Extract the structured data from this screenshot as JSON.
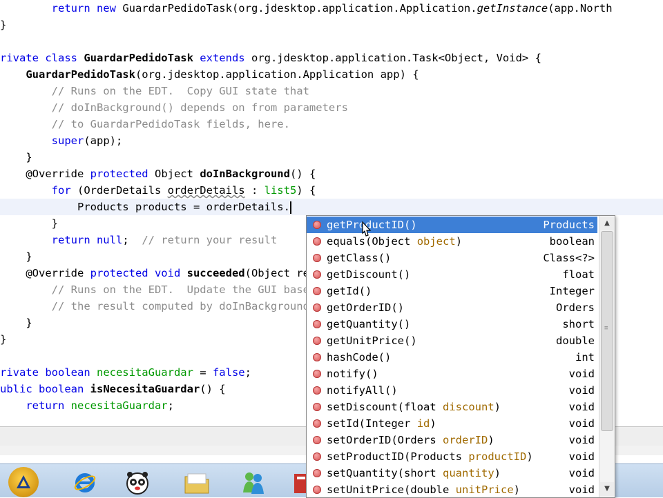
{
  "editor": {
    "lines": [
      {
        "segs": [
          {
            "t": "        return new ",
            "c": "kw"
          },
          {
            "t": "GuardarPedidoTask(org.jdesktop.application.Application.",
            "c": "typ"
          },
          {
            "t": "getInstance",
            "c": "it"
          },
          {
            "t": "(app.North",
            "c": "typ"
          }
        ]
      },
      {
        "segs": [
          {
            "t": "}",
            "c": "typ"
          }
        ]
      },
      {
        "segs": [
          {
            "t": "",
            "c": "typ"
          }
        ]
      },
      {
        "segs": [
          {
            "t": "rivate class ",
            "c": "kw"
          },
          {
            "t": "GuardarPedidoTask",
            "c": "bold"
          },
          {
            "t": " extends ",
            "c": "kw"
          },
          {
            "t": "org.jdesktop.application.Task<Object, Void> {",
            "c": "typ"
          }
        ]
      },
      {
        "segs": [
          {
            "t": "    GuardarPedidoTask",
            "c": "bold"
          },
          {
            "t": "(org.jdesktop.application.Application app) {",
            "c": "typ"
          }
        ]
      },
      {
        "segs": [
          {
            "t": "        // Runs on the EDT.  Copy GUI state that",
            "c": "cm"
          }
        ]
      },
      {
        "segs": [
          {
            "t": "        // doInBackground() depends on from parameters",
            "c": "cm"
          }
        ]
      },
      {
        "segs": [
          {
            "t": "        // to GuardarPedidoTask fields, here.",
            "c": "cm"
          }
        ]
      },
      {
        "segs": [
          {
            "t": "        super",
            "c": "kw"
          },
          {
            "t": "(app);",
            "c": "typ"
          }
        ]
      },
      {
        "segs": [
          {
            "t": "    }",
            "c": "typ"
          }
        ]
      },
      {
        "segs": [
          {
            "t": "    @Override ",
            "c": "typ"
          },
          {
            "t": "protected ",
            "c": "kw"
          },
          {
            "t": "Object ",
            "c": "typ"
          },
          {
            "t": "doInBackground",
            "c": "bold"
          },
          {
            "t": "() {",
            "c": "typ"
          }
        ]
      },
      {
        "segs": [
          {
            "t": "        for ",
            "c": "kw"
          },
          {
            "t": "(OrderDetails ",
            "c": "typ"
          },
          {
            "t": "orderDetails",
            "c": "wavy"
          },
          {
            "t": " : ",
            "c": "typ"
          },
          {
            "t": "list5",
            "c": "fld"
          },
          {
            "t": ") {",
            "c": "typ"
          }
        ]
      },
      {
        "segs": [
          {
            "t": "            Products products = orderDetails.",
            "c": "typ"
          }
        ],
        "current": true
      },
      {
        "segs": [
          {
            "t": "        }",
            "c": "typ"
          }
        ]
      },
      {
        "segs": [
          {
            "t": "        return null",
            "c": "kw"
          },
          {
            "t": ";  ",
            "c": "typ"
          },
          {
            "t": "// return your result",
            "c": "cm"
          }
        ]
      },
      {
        "segs": [
          {
            "t": "    }",
            "c": "typ"
          }
        ]
      },
      {
        "segs": [
          {
            "t": "    @Override ",
            "c": "typ"
          },
          {
            "t": "protected void ",
            "c": "kw"
          },
          {
            "t": "succeeded",
            "c": "bold"
          },
          {
            "t": "(Object result) {",
            "c": "typ"
          }
        ]
      },
      {
        "segs": [
          {
            "t": "        // Runs on the EDT.  Update the GUI based on",
            "c": "cm"
          }
        ]
      },
      {
        "segs": [
          {
            "t": "        // the result computed by doInBackground().",
            "c": "cm"
          }
        ]
      },
      {
        "segs": [
          {
            "t": "    }",
            "c": "typ"
          }
        ]
      },
      {
        "segs": [
          {
            "t": "}",
            "c": "typ"
          }
        ]
      },
      {
        "segs": [
          {
            "t": "",
            "c": "typ"
          }
        ]
      },
      {
        "segs": [
          {
            "t": "rivate boolean ",
            "c": "kw"
          },
          {
            "t": "necesitaGuardar",
            "c": "fld"
          },
          {
            "t": " = ",
            "c": "typ"
          },
          {
            "t": "false",
            "c": "kw"
          },
          {
            "t": ";",
            "c": "typ"
          }
        ]
      },
      {
        "segs": [
          {
            "t": "ublic boolean ",
            "c": "kw"
          },
          {
            "t": "isNecesitaGuardar",
            "c": "bold"
          },
          {
            "t": "() {",
            "c": "typ"
          }
        ]
      },
      {
        "segs": [
          {
            "t": "    return ",
            "c": "kw"
          },
          {
            "t": "necesitaGuardar",
            "c": "fld"
          },
          {
            "t": ";",
            "c": "typ"
          }
        ]
      }
    ]
  },
  "completion": {
    "selected_index": 0,
    "items": [
      {
        "name": "getProductID",
        "params": [],
        "returns": "Products"
      },
      {
        "name": "equals",
        "params": [
          {
            "type": "Object",
            "name": "object"
          }
        ],
        "returns": "boolean"
      },
      {
        "name": "getClass",
        "params": [],
        "returns": "Class<?>"
      },
      {
        "name": "getDiscount",
        "params": [],
        "returns": "float"
      },
      {
        "name": "getId",
        "params": [],
        "returns": "Integer"
      },
      {
        "name": "getOrderID",
        "params": [],
        "returns": "Orders"
      },
      {
        "name": "getQuantity",
        "params": [],
        "returns": "short"
      },
      {
        "name": "getUnitPrice",
        "params": [],
        "returns": "double"
      },
      {
        "name": "hashCode",
        "params": [],
        "returns": "int"
      },
      {
        "name": "notify",
        "params": [],
        "returns": "void"
      },
      {
        "name": "notifyAll",
        "params": [],
        "returns": "void"
      },
      {
        "name": "setDiscount",
        "params": [
          {
            "type": "float",
            "name": "discount"
          }
        ],
        "returns": "void"
      },
      {
        "name": "setId",
        "params": [
          {
            "type": "Integer",
            "name": "id"
          }
        ],
        "returns": "void"
      },
      {
        "name": "setOrderID",
        "params": [
          {
            "type": "Orders",
            "name": "orderID"
          }
        ],
        "returns": "void"
      },
      {
        "name": "setProductID",
        "params": [
          {
            "type": "Products",
            "name": "productID"
          }
        ],
        "returns": "void"
      },
      {
        "name": "setQuantity",
        "params": [
          {
            "type": "short",
            "name": "quantity"
          }
        ],
        "returns": "void"
      },
      {
        "name": "setUnitPrice",
        "params": [
          {
            "type": "double",
            "name": "unitPrice"
          }
        ],
        "returns": "void"
      }
    ],
    "scroll_up_glyph": "▲",
    "scroll_down_glyph": "▼",
    "grip_glyph": "≡"
  },
  "colors": {
    "keyword": "#0000e6",
    "comment": "#8c8c8c",
    "field": "#009900",
    "selection": "#3d7fd6",
    "param_name": "#a06a00"
  },
  "taskbar": {
    "icons": [
      "start-orb-icon",
      "internet-explorer-icon",
      "panda-antivirus-icon",
      "folder-icon",
      "messenger-icon",
      "application-icon"
    ]
  }
}
